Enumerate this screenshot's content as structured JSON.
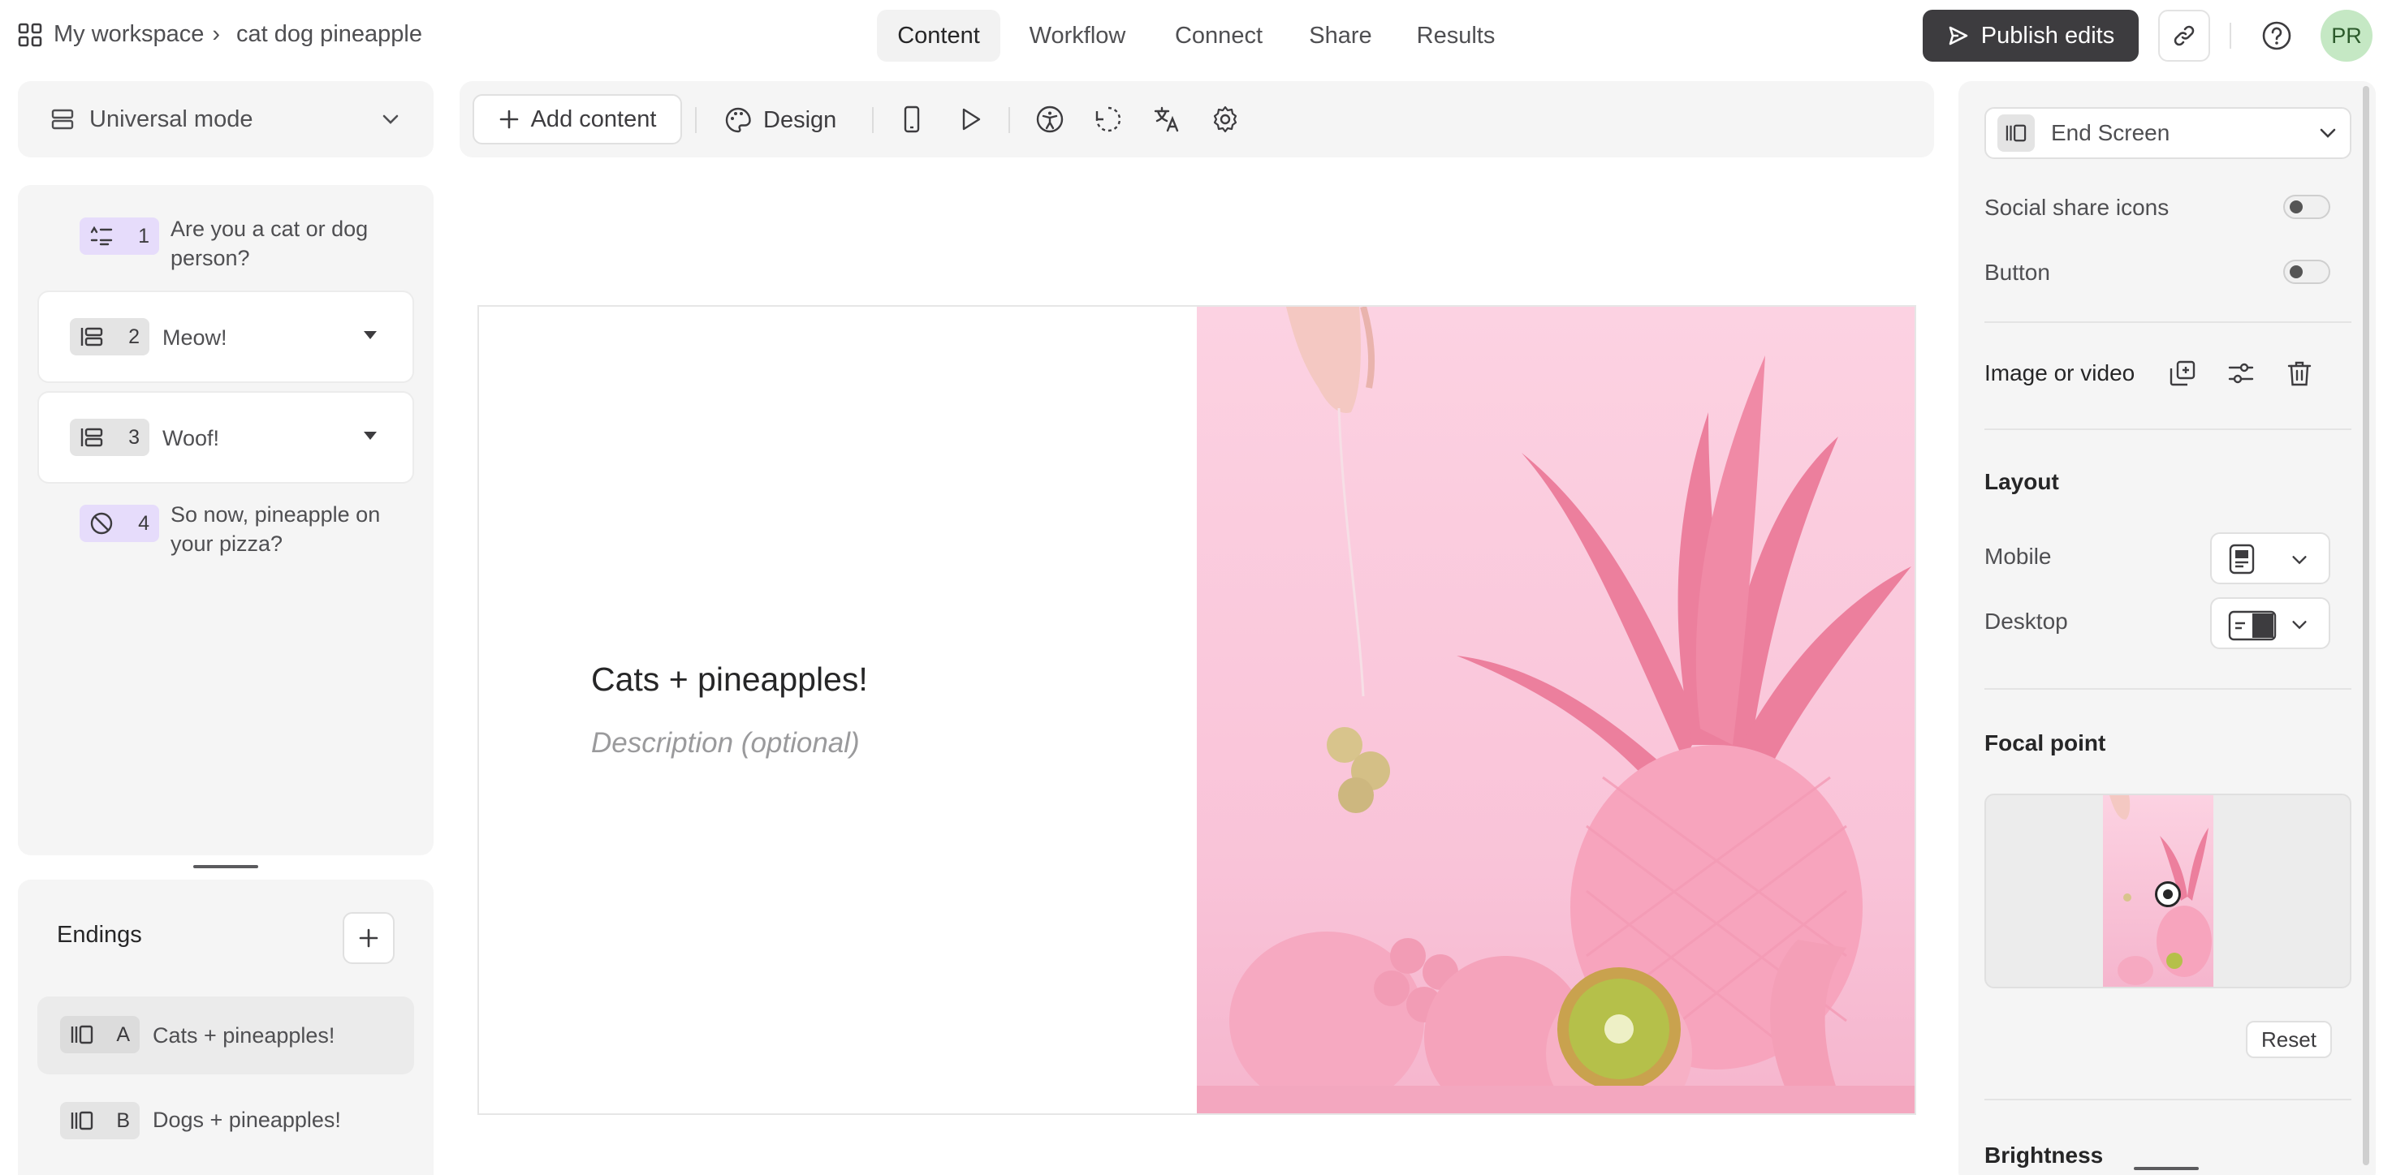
{
  "breadcrumb": {
    "workspace": "My workspace",
    "separator": "›",
    "project": "cat dog pineapple"
  },
  "nav": {
    "tabs": [
      "Content",
      "Workflow",
      "Connect",
      "Share",
      "Results"
    ],
    "active": "Content"
  },
  "header": {
    "publish_label": "Publish edits",
    "avatar_initials": "PR"
  },
  "left": {
    "mode": "Universal mode",
    "questions": [
      {
        "num": "1",
        "text": "Are you a cat or dog person?",
        "icon": "rating-list-icon",
        "expandable": false
      },
      {
        "num": "2",
        "text": "Meow!",
        "icon": "statement-icon",
        "expandable": true
      },
      {
        "num": "3",
        "text": "Woof!",
        "icon": "statement-icon",
        "expandable": true
      },
      {
        "num": "4",
        "text": "So now, pineapple on your pizza?",
        "icon": "no-icon",
        "expandable": false
      }
    ],
    "endings_title": "Endings",
    "endings": [
      {
        "letter": "A",
        "text": "Cats + pineapples!",
        "selected": true
      },
      {
        "letter": "B",
        "text": "Dogs + pineapples!",
        "selected": false
      }
    ]
  },
  "toolbar": {
    "add_content": "Add content",
    "design": "Design"
  },
  "canvas": {
    "title": "Cats + pineapples!",
    "description_placeholder": "Description (optional)"
  },
  "right": {
    "screen_type": "End Screen",
    "social_share": "Social share icons",
    "button": "Button",
    "image_or_video": "Image or video",
    "layout": "Layout",
    "mobile": "Mobile",
    "desktop": "Desktop",
    "focal_point": "Focal point",
    "reset": "Reset",
    "brightness": "Brightness"
  },
  "colors": {
    "accent_dark": "#3d3c3f",
    "purple_badge": "#e6dcfb",
    "avatar_bg": "#c5e8c4",
    "photo_pink": "#f9c3d8"
  }
}
